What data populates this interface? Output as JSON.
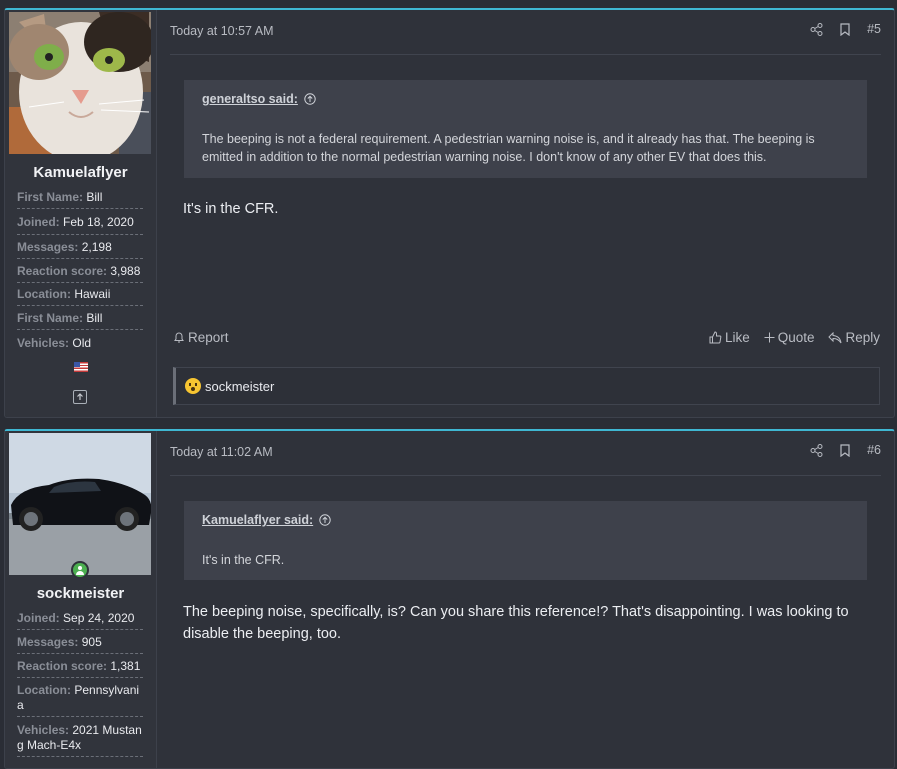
{
  "posts": [
    {
      "user": {
        "name": "Kamuelaflyer",
        "facts": [
          {
            "k": "First Name:",
            "v": "Bill"
          },
          {
            "k": "Joined:",
            "v": "Feb 18, 2020"
          },
          {
            "k": "Messages:",
            "v": "2,198"
          },
          {
            "k": "Reaction score:",
            "v": "3,988"
          },
          {
            "k": "Location:",
            "v": "Hawaii"
          },
          {
            "k": "First Name:",
            "v": "Bill"
          },
          {
            "k": "Vehicles:",
            "v": "Old"
          }
        ]
      },
      "date": "Today at 10:57 AM",
      "number": "#5",
      "quote": {
        "author": "generaltso said:",
        "text": "The beeping is not a federal requirement. A pedestrian warning noise is, and it already has that. The beeping is emitted in addition to the normal pedestrian warning noise. I don't know of any other EV that does this."
      },
      "message": "It's in the CFR.",
      "actions": {
        "report": "Report",
        "like": "Like",
        "quote": "Quote",
        "reply": "Reply"
      },
      "reaction_user": "sockmeister"
    },
    {
      "user": {
        "name": "sockmeister",
        "facts": [
          {
            "k": "Joined:",
            "v": "Sep 24, 2020"
          },
          {
            "k": "Messages:",
            "v": "905"
          },
          {
            "k": "Reaction score:",
            "v": "1,381"
          },
          {
            "k": "Location:",
            "v": "Pennsylvania"
          },
          {
            "k": "Vehicles:",
            "v": "2021 Mustang Mach-E4x"
          }
        ]
      },
      "date": "Today at 11:02 AM",
      "number": "#6",
      "quote": {
        "author": "Kamuelaflyer said:",
        "text": "It's in the CFR."
      },
      "message": "The beeping noise, specifically, is? Can you share this reference!? That's disappointing. I was looking to disable the beeping, too."
    }
  ],
  "icons": {
    "share": "share-icon",
    "bookmark": "bookmark-icon",
    "bell": "bell-icon",
    "thumb": "thumbs-up-icon",
    "plus": "plus-icon",
    "reply": "reply-icon",
    "up": "arrow-up-circle-icon"
  },
  "colors": {
    "accent": "#3fb7d2",
    "online": "#4caf50"
  }
}
